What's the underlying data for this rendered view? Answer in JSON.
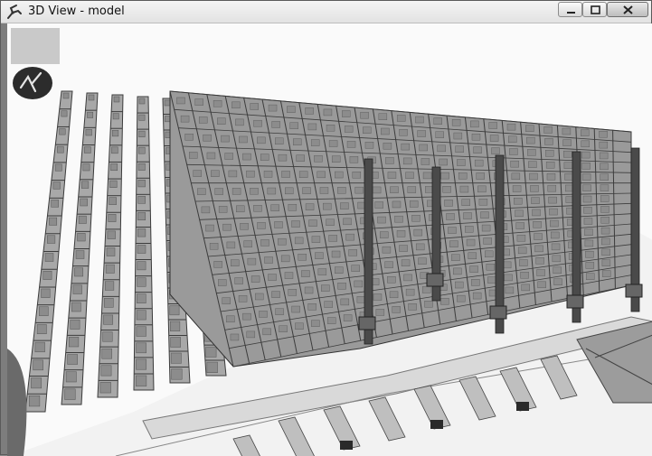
{
  "window": {
    "title": "3D View - model",
    "icon": "robot-arm-icon",
    "controls": {
      "minimize": "minimize-icon",
      "maximize": "maximize-icon",
      "close": "close-icon"
    }
  },
  "viewport": {
    "view_cube_icon": "view-swatch",
    "logo_icon": "navigation-logo-icon",
    "scene": {
      "description_icon": "warehouse-racks-3d-scene",
      "rack_rows": 13,
      "stacker_cranes": 5,
      "conveyor_units": 8
    }
  },
  "colors": {
    "background": "#fafafa",
    "rack": "#3c3c3c",
    "bin": "#8c8c8c",
    "conveyor": "#bfbfbf",
    "titlebar": "#ececec"
  }
}
